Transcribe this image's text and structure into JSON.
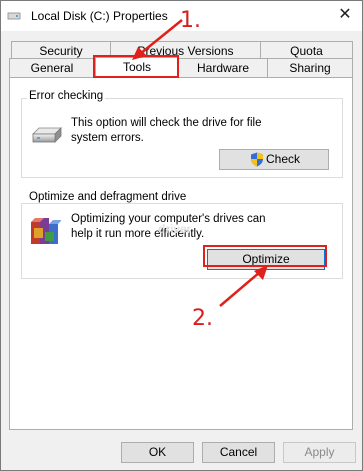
{
  "window": {
    "title": "Local Disk (C:) Properties",
    "close_glyph": "✕"
  },
  "tabs": {
    "row1": [
      "Security",
      "Previous Versions",
      "Quota"
    ],
    "row2": [
      "General",
      "Tools",
      "Hardware",
      "Sharing"
    ],
    "active": "Tools"
  },
  "error_checking": {
    "title": "Error checking",
    "description": "This option will check the drive for file system errors.",
    "button_label": "Check",
    "icon": "drive-icon",
    "button_icon": "shield-icon"
  },
  "optimize": {
    "title": "Optimize and defragment drive",
    "description": "Optimizing your computer's drives can help it run more efficiently.",
    "button_label": "Optimize",
    "icon": "defrag-icon",
    "watermark": "driver"
  },
  "footer": {
    "ok": "OK",
    "cancel": "Cancel",
    "apply": "Apply"
  },
  "annotations": {
    "step1": "1.",
    "step2": "2.",
    "highlight_color": "#e0201b"
  }
}
